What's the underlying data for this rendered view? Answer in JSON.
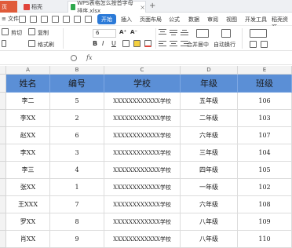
{
  "tabs": {
    "home": "页",
    "docer": "稻壳",
    "file": "WPS表格怎么按首字母排序.xlsx",
    "close": "×",
    "add": "+"
  },
  "menu": {
    "file": "≡ 文件",
    "start": "开始",
    "items": [
      "插入",
      "页面布局",
      "公式",
      "数据",
      "审阅",
      "视图",
      "开发工具",
      "稻壳资源"
    ]
  },
  "ribbon": {
    "cut": "剪切",
    "copy": "复制",
    "format_painter": "格式刷",
    "font_size": "6",
    "increase_font": "A⁺",
    "decrease_font": "A⁻",
    "bold": "B",
    "italic": "I",
    "underline": "U",
    "merge": "合并居中",
    "wrap": "自动换行"
  },
  "formula_bar": {
    "fx": "fx",
    "value": ""
  },
  "columns": [
    "A",
    "B",
    "C",
    "D",
    "E"
  ],
  "table": {
    "headers": [
      "姓名",
      "编号",
      "学校",
      "年级",
      "班级"
    ],
    "rows": [
      [
        "李二",
        "5",
        "XXXXXXXXXXXX学校",
        "五年级",
        "106"
      ],
      [
        "李XX",
        "2",
        "XXXXXXXXXXXX学校",
        "二年级",
        "103"
      ],
      [
        "赵XX",
        "6",
        "XXXXXXXXXXXX学校",
        "六年级",
        "107"
      ],
      [
        "李XX",
        "3",
        "XXXXXXXXXXXX学校",
        "三年级",
        "104"
      ],
      [
        "李三",
        "4",
        "XXXXXXXXXXXX学校",
        "四年级",
        "105"
      ],
      [
        "张XX",
        "1",
        "XXXXXXXXXXXX学校",
        "一年级",
        "102"
      ],
      [
        "王XXX",
        "7",
        "XXXXXXXXXXXX学校",
        "六年级",
        "108"
      ],
      [
        "罗XX",
        "8",
        "XXXXXXXXXXXX学校",
        "八年级",
        "109"
      ],
      [
        "肖XX",
        "9",
        "XXXXXXXXXXXX学校",
        "八年级",
        "110"
      ]
    ]
  }
}
